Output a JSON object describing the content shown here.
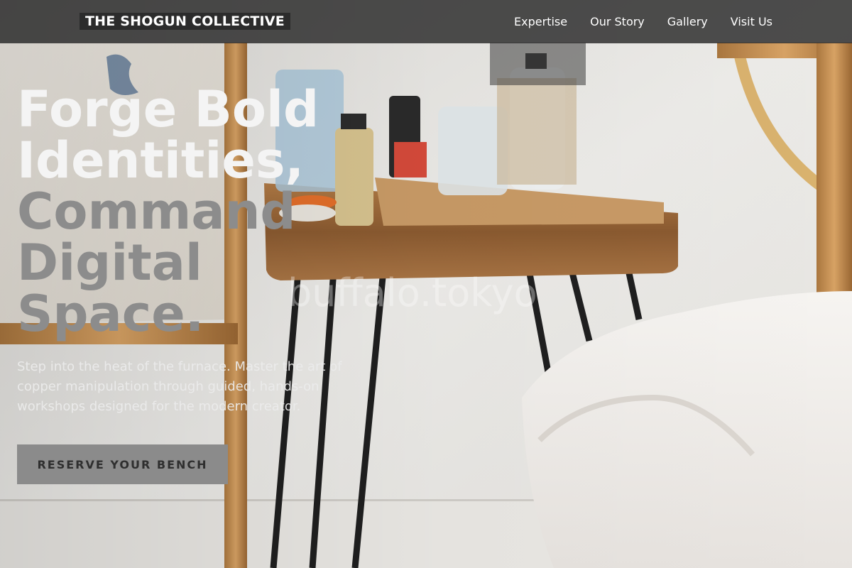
{
  "header": {
    "brand": "THE SHOGUN COLLECTIVE",
    "nav": [
      {
        "label": "Expertise"
      },
      {
        "label": "Our Story"
      },
      {
        "label": "Gallery"
      },
      {
        "label": "Visit Us"
      }
    ]
  },
  "hero": {
    "headline_light": [
      "Forge Bold",
      "Identities,"
    ],
    "headline_grey": [
      "Command",
      "Digital",
      "Space."
    ],
    "subtext": "Step into the heat of the furnace. Master the art of copper manipulation through guided, hands-on workshops designed for the modern creator.",
    "cta_label": "RESERVE YOUR BENCH",
    "watermark": "buffalo.tokyo"
  },
  "colors": {
    "nav_background": "#282828",
    "headline_light": "#f4f4f4",
    "headline_grey": "#8c8c8c",
    "cta_background": "#8b8b8b",
    "cta_text": "#2f2f2f"
  }
}
